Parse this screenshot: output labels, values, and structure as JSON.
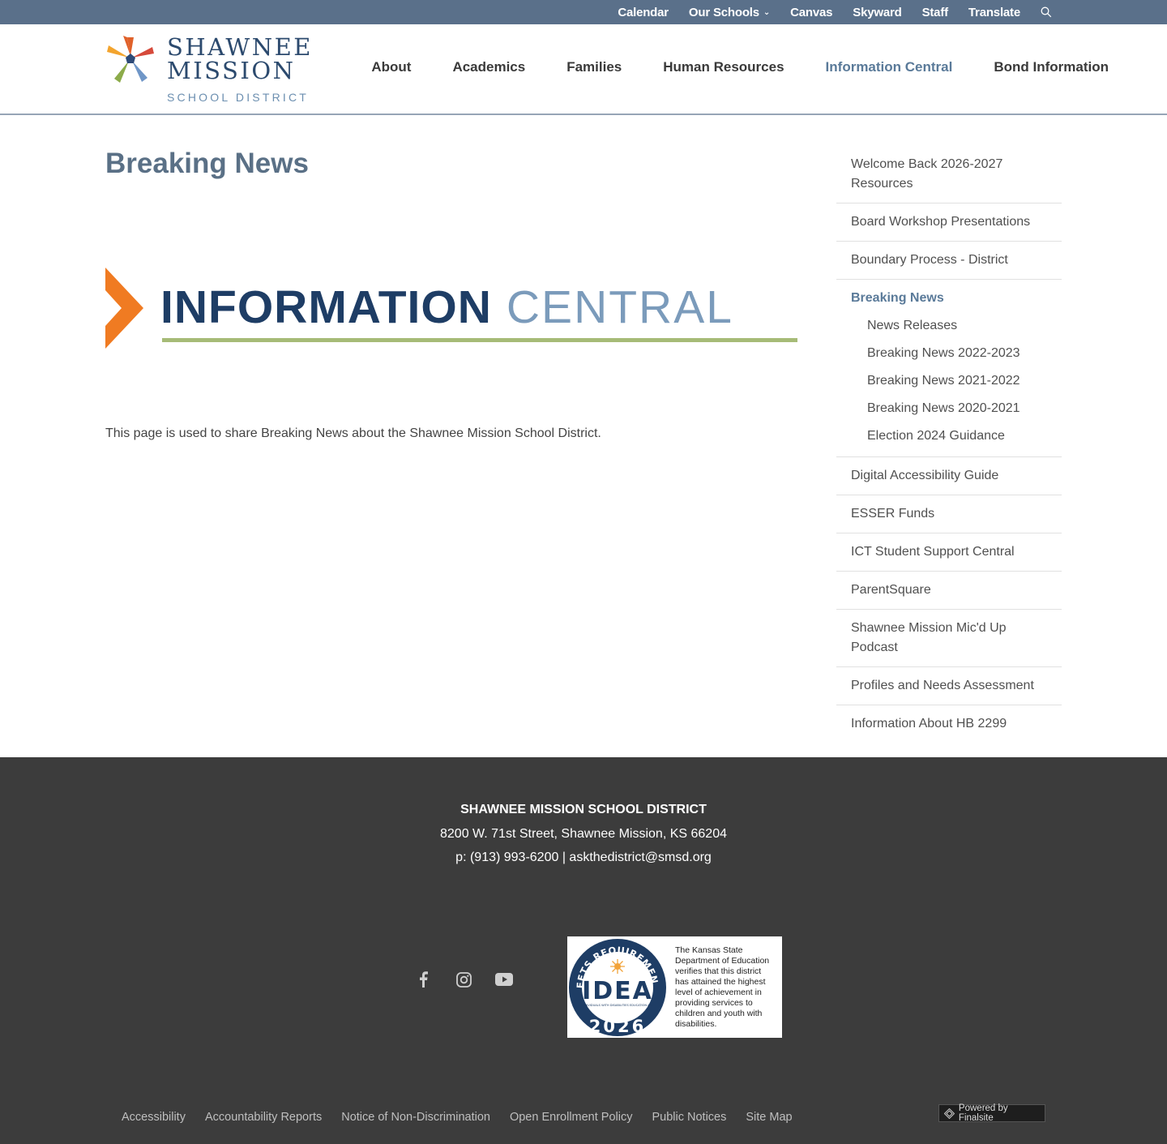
{
  "utility_nav": {
    "items": [
      {
        "label": "Calendar"
      },
      {
        "label": "Our Schools",
        "has_dropdown": true
      },
      {
        "label": "Canvas"
      },
      {
        "label": "Skyward"
      },
      {
        "label": "Staff"
      },
      {
        "label": "Translate"
      }
    ],
    "search_icon": "search-icon"
  },
  "logo": {
    "line1": "SHAWNEE",
    "line2": "MISSION",
    "line3": "SCHOOL DISTRICT"
  },
  "main_nav": {
    "items": [
      {
        "label": "About"
      },
      {
        "label": "Academics"
      },
      {
        "label": "Families"
      },
      {
        "label": "Human Resources"
      },
      {
        "label": "Information Central",
        "active": true
      },
      {
        "label": "Bond Information"
      }
    ]
  },
  "page": {
    "title": "Breaking News",
    "banner_bold": "INFORMATION",
    "banner_light": "CENTRAL",
    "intro": "This page is used to share Breaking News about the Shawnee Mission School District."
  },
  "sidebar": {
    "items": [
      {
        "label": "Welcome Back 2026-2027 Resources"
      },
      {
        "label": "Board Workshop Presentations"
      },
      {
        "label": "Boundary Process - District"
      },
      {
        "label": "Breaking News",
        "active": true,
        "children": [
          {
            "label": "News Releases"
          },
          {
            "label": "Breaking News 2022-2023"
          },
          {
            "label": "Breaking News 2021-2022"
          },
          {
            "label": "Breaking News 2020-2021"
          },
          {
            "label": "Election 2024 Guidance"
          }
        ]
      },
      {
        "label": "Digital Accessibility Guide"
      },
      {
        "label": "ESSER Funds"
      },
      {
        "label": "ICT Student Support Central"
      },
      {
        "label": "ParentSquare"
      },
      {
        "label": "Shawnee Mission Mic'd Up Podcast"
      },
      {
        "label": "Profiles and Needs Assessment"
      },
      {
        "label": "Information About HB 2299"
      }
    ]
  },
  "footer": {
    "org_name": "SHAWNEE MISSION SCHOOL DISTRICT",
    "address": "8200 W. 71st Street, Shawnee Mission, KS 66204",
    "contact": "p: (913) 993-6200 | askthedistrict@smsd.org",
    "social": [
      "facebook-icon",
      "instagram-icon",
      "youtube-icon"
    ],
    "idea_badge": {
      "ring_text": "MEETS REQUIREMENTS",
      "title": "IDEA",
      "subtitle": "INDIVIDUALS WITH DISABILITIES EDUCATION ACT",
      "year": "2026",
      "description": "The Kansas State Department of Education verifies that this district has attained the highest level of achievement in providing services to children and youth with disabilities."
    },
    "links": [
      {
        "label": "Accessibility"
      },
      {
        "label": "Accountability Reports"
      },
      {
        "label": "Notice of Non-Discrimination"
      },
      {
        "label": "Open Enrollment Policy"
      },
      {
        "label": "Public Notices"
      },
      {
        "label": "Site Map"
      }
    ],
    "powered_by": "Powered by Finalsite"
  },
  "colors": {
    "utility_bar": "#5a708a",
    "nav_active": "#5a7a99",
    "title": "#5a7086",
    "banner_dark": "#1e3d65",
    "banner_light": "#7b9bbb",
    "banner_rule": "#a6bb77",
    "banner_arrow": "#f07b22",
    "footer_bg": "#3c3c3c"
  }
}
